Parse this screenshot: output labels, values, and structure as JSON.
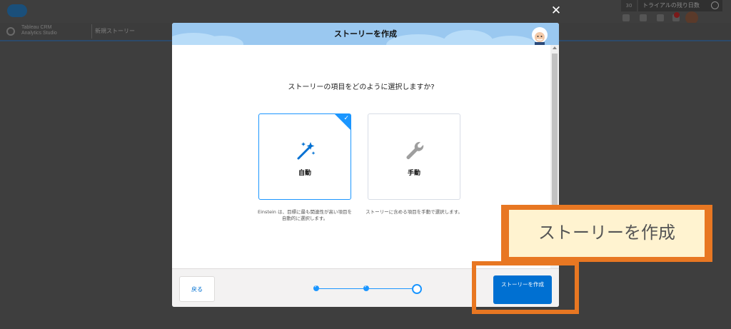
{
  "background": {
    "app_name_line1": "Tableau CRM",
    "app_name_line2": "Analytics Studio",
    "tab_label": "新規ストーリー",
    "trial_text": "トライアルの残り日数",
    "trial_count": "30"
  },
  "modal": {
    "close_glyph": "✕",
    "title": "ストーリーを作成",
    "question": "ストーリーの項目をどのように選択しますか?",
    "options": [
      {
        "label": "自動",
        "icon": "magic-wand-icon",
        "selected": true,
        "description": "Einstein は、目標に最も関連性が高い項目を自動的に選択します。"
      },
      {
        "label": "手動",
        "icon": "wrench-icon",
        "selected": false,
        "description": "ストーリーに含める項目を手動で選択します。"
      }
    ],
    "footer": {
      "back_label": "戻る",
      "create_label": "ストーリーを作成",
      "steps_total": 3,
      "current_step": 3
    }
  },
  "annotation": {
    "callout_text": "ストーリーを作成"
  },
  "colors": {
    "accent": "#1b96ff",
    "button": "#0070d2",
    "callout_border": "#e87722",
    "callout_fill": "#fff3d0"
  }
}
